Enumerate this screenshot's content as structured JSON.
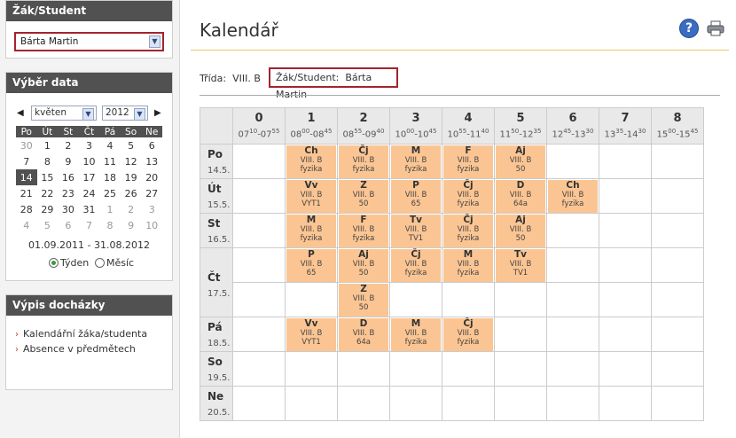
{
  "student_box": {
    "title": "Žák/Student",
    "selected": "Bárta Martin"
  },
  "date_box": {
    "title": "Výběr data",
    "month": "květen",
    "year": "2012",
    "weekdays": [
      "Po",
      "Út",
      "St",
      "Čt",
      "Pá",
      "So",
      "Ne"
    ],
    "weeks": [
      [
        "30",
        "1",
        "2",
        "3",
        "4",
        "5",
        "6"
      ],
      [
        "7",
        "8",
        "9",
        "10",
        "11",
        "12",
        "13"
      ],
      [
        "14",
        "15",
        "16",
        "17",
        "18",
        "19",
        "20"
      ],
      [
        "21",
        "22",
        "23",
        "24",
        "25",
        "26",
        "27"
      ],
      [
        "28",
        "29",
        "30",
        "31",
        "1",
        "2",
        "3"
      ],
      [
        "4",
        "5",
        "6",
        "7",
        "8",
        "9",
        "10"
      ]
    ],
    "selected_day": "14",
    "period": "01.09.2011 - 31.08.2012",
    "view_week": "Týden",
    "view_month": "Měsíc"
  },
  "attendance_box": {
    "title": "Výpis docházky",
    "links": [
      "Kalendářní žáka/studenta",
      "Absence v předmětech"
    ]
  },
  "main": {
    "title": "Kalendář",
    "class_label": "Třída:",
    "class_value": "VIII. B",
    "student_label": "Žák/Student:",
    "student_value": "Bárta Martin"
  },
  "periods": [
    {
      "n": "0",
      "from_h": "07",
      "from_m": "10",
      "to_h": "07",
      "to_m": "55"
    },
    {
      "n": "1",
      "from_h": "08",
      "from_m": "00",
      "to_h": "08",
      "to_m": "45"
    },
    {
      "n": "2",
      "from_h": "08",
      "from_m": "55",
      "to_h": "09",
      "to_m": "40"
    },
    {
      "n": "3",
      "from_h": "10",
      "from_m": "00",
      "to_h": "10",
      "to_m": "45"
    },
    {
      "n": "4",
      "from_h": "10",
      "from_m": "55",
      "to_h": "11",
      "to_m": "40"
    },
    {
      "n": "5",
      "from_h": "11",
      "from_m": "50",
      "to_h": "12",
      "to_m": "35"
    },
    {
      "n": "6",
      "from_h": "12",
      "from_m": "45",
      "to_h": "13",
      "to_m": "30"
    },
    {
      "n": "7",
      "from_h": "13",
      "from_m": "35",
      "to_h": "14",
      "to_m": "30"
    },
    {
      "n": "8",
      "from_h": "15",
      "from_m": "00",
      "to_h": "15",
      "to_m": "45"
    }
  ],
  "days": [
    {
      "name": "Po",
      "date": "14.5.",
      "rows": [
        [
          null,
          [
            "Ch",
            "VIII. B",
            "fyzika"
          ],
          [
            "Čj",
            "VIII. B",
            "fyzika"
          ],
          [
            "M",
            "VIII. B",
            "fyzika"
          ],
          [
            "F",
            "VIII. B",
            "fyzika"
          ],
          [
            "Aj",
            "VIII. B",
            "50"
          ],
          null,
          null,
          null
        ]
      ]
    },
    {
      "name": "Út",
      "date": "15.5.",
      "rows": [
        [
          null,
          [
            "Vv",
            "VIII. B",
            "VYT1"
          ],
          [
            "Z",
            "VIII. B",
            "50"
          ],
          [
            "P",
            "VIII. B",
            "65"
          ],
          [
            "Čj",
            "VIII. B",
            "fyzika"
          ],
          [
            "D",
            "VIII. B",
            "64a"
          ],
          [
            "Ch",
            "VIII. B",
            "fyzika"
          ],
          null,
          null
        ]
      ]
    },
    {
      "name": "St",
      "date": "16.5.",
      "rows": [
        [
          null,
          [
            "M",
            "VIII. B",
            "fyzika"
          ],
          [
            "F",
            "VIII. B",
            "fyzika"
          ],
          [
            "Tv",
            "VIII. B",
            "TV1"
          ],
          [
            "Čj",
            "VIII. B",
            "fyzika"
          ],
          [
            "Aj",
            "VIII. B",
            "50"
          ],
          null,
          null,
          null
        ]
      ]
    },
    {
      "name": "Čt",
      "date": "17.5.",
      "rows": [
        [
          null,
          [
            "P",
            "VIII. B",
            "65"
          ],
          [
            "Aj",
            "VIII. B",
            "50"
          ],
          [
            "Čj",
            "VIII. B",
            "fyzika"
          ],
          [
            "M",
            "VIII. B",
            "fyzika"
          ],
          [
            "Tv",
            "VIII. B",
            "TV1"
          ],
          null,
          null,
          null
        ],
        [
          null,
          null,
          [
            "Z",
            "VIII. B",
            "50"
          ],
          null,
          null,
          null,
          null,
          null,
          null
        ]
      ]
    },
    {
      "name": "Pá",
      "date": "18.5.",
      "rows": [
        [
          null,
          [
            "Vv",
            "VIII. B",
            "VYT1"
          ],
          [
            "D",
            "VIII. B",
            "64a"
          ],
          [
            "M",
            "VIII. B",
            "fyzika"
          ],
          [
            "Čj",
            "VIII. B",
            "fyzika"
          ],
          null,
          null,
          null,
          null
        ]
      ]
    },
    {
      "name": "So",
      "date": "19.5.",
      "rows": [
        [
          null,
          null,
          null,
          null,
          null,
          null,
          null,
          null,
          null
        ]
      ]
    },
    {
      "name": "Ne",
      "date": "20.5.",
      "rows": [
        [
          null,
          null,
          null,
          null,
          null,
          null,
          null,
          null,
          null
        ]
      ]
    }
  ]
}
